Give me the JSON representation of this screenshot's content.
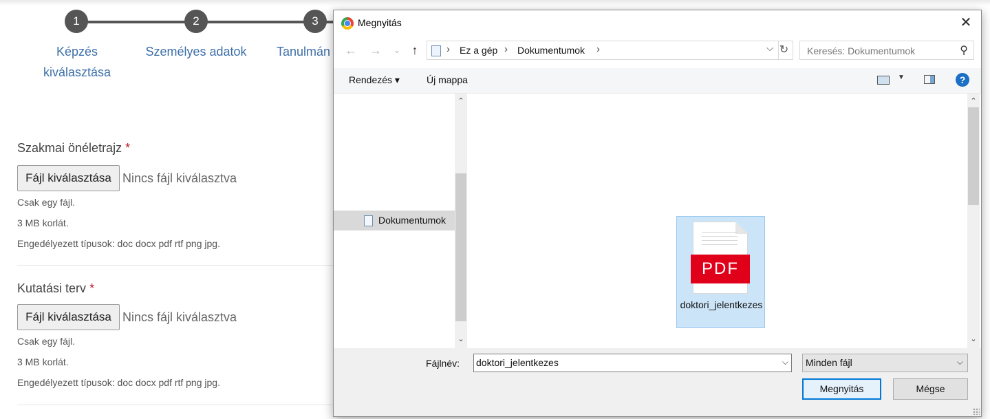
{
  "page": {
    "steps": [
      {
        "number": "1",
        "label_line1": "Képzés",
        "label_line2": "kiválasztása"
      },
      {
        "number": "2",
        "label_line1": "Személyes adatok",
        "label_line2": ""
      },
      {
        "number": "3",
        "label_line1": "Tanulmán",
        "label_line2": ""
      }
    ],
    "fields": [
      {
        "title": "Szakmai önéletrajz",
        "required_mark": "*",
        "button_label": "Fájl kiválasztása",
        "no_file": "Nincs fájl kiválasztva",
        "hints": [
          "Csak egy fájl.",
          "3 MB korlát.",
          "Engedélyezett típusok: doc docx pdf rtf png jpg."
        ]
      },
      {
        "title": "Kutatási terv",
        "required_mark": "*",
        "button_label": "Fájl kiválasztása",
        "no_file": "Nincs fájl kiválasztva",
        "hints": [
          "Csak egy fájl.",
          "3 MB korlát.",
          "Engedélyezett típusok: doc docx pdf rtf png jpg."
        ]
      }
    ]
  },
  "dialog": {
    "title": "Megnyitás",
    "close_glyph": "✕",
    "nav": {
      "back": "←",
      "forward": "→",
      "recent": "⌄",
      "up": "↑"
    },
    "breadcrumb": [
      "Ez a gép",
      "Dokumentumok"
    ],
    "crumb_separator": "›",
    "refresh_glyph": "↻",
    "search_placeholder": "Keresés: Dokumentumok",
    "search_glyph": "⚲",
    "toolbar": {
      "organize": "Rendezés ▾",
      "new_folder": "Új mappa",
      "help": "?"
    },
    "nav_pane": {
      "selected_item": "Dokumentumok"
    },
    "scroll_up": "⌃",
    "scroll_down": "⌄",
    "files": [
      {
        "name": "doktori_jelentkezes",
        "type_label": "PDF",
        "selected": true
      }
    ],
    "filename_label": "Fájlnév:",
    "filename_value": "doktori_jelentkezes",
    "filetype_value": "Minden fájl",
    "dropdown_glyph": "⌵",
    "open_button": "Megnyitás",
    "cancel_button": "Mégse",
    "accent_color": "#0078d7",
    "selection_color": "#cce4f7"
  }
}
